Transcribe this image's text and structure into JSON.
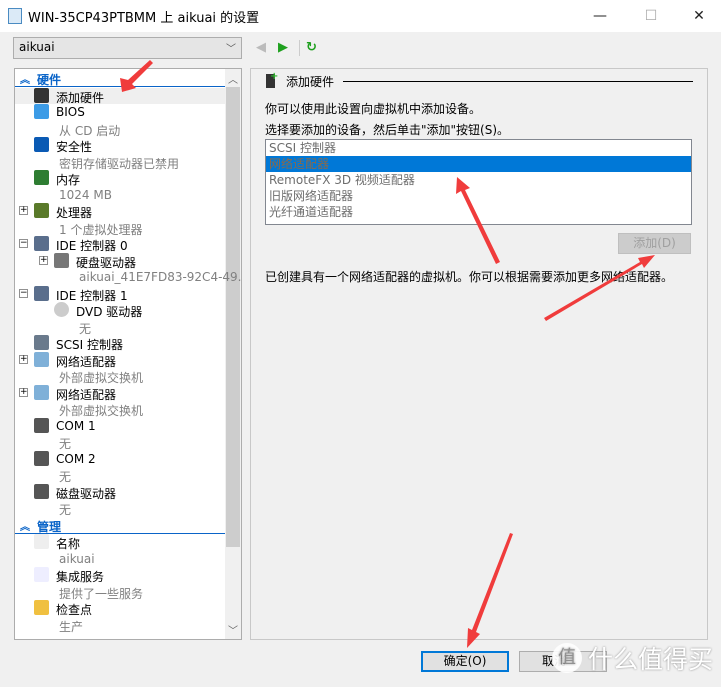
{
  "window": {
    "title": "WIN-35CP43PTBMM 上 aikuai 的设置",
    "minimize": "—",
    "maximize": "☐",
    "close": "✕"
  },
  "toolbar": {
    "vm_select": "aikuai",
    "back": "◀",
    "forward": "▶",
    "refresh": "↻"
  },
  "sidebar": {
    "hardware_label": "硬件",
    "management_label": "管理",
    "hardware": [
      {
        "label": "添加硬件",
        "sub": null,
        "expander": null,
        "icon": "add-hardware-icon"
      },
      {
        "label": "BIOS",
        "sub": "从 CD 启动",
        "expander": null,
        "icon": "bios-monitor-icon"
      },
      {
        "label": "安全性",
        "sub": "密钥存储驱动器已禁用",
        "expander": null,
        "icon": "shield-icon"
      },
      {
        "label": "内存",
        "sub": "1024 MB",
        "expander": null,
        "icon": "memory-icon"
      },
      {
        "label": "处理器",
        "sub": "1 个虚拟处理器",
        "expander": "+",
        "icon": "cpu-icon"
      },
      {
        "label": "IDE 控制器 0",
        "sub": null,
        "expander": "−",
        "icon": "ide-controller-icon"
      },
      {
        "label": "硬盘驱动器",
        "sub": "aikuai_41E7FD83-92C4-49...",
        "expander": "+",
        "icon": "hard-drive-icon",
        "child": true
      },
      {
        "label": "IDE 控制器 1",
        "sub": null,
        "expander": "−",
        "icon": "ide-controller-icon"
      },
      {
        "label": "DVD 驱动器",
        "sub": "无",
        "expander": null,
        "icon": "dvd-icon",
        "child": true
      },
      {
        "label": "SCSI 控制器",
        "sub": null,
        "expander": null,
        "icon": "scsi-icon"
      },
      {
        "label": "网络适配器",
        "sub": "外部虚拟交换机",
        "expander": "+",
        "icon": "network-adapter-icon"
      },
      {
        "label": "网络适配器",
        "sub": "外部虚拟交换机",
        "expander": "+",
        "icon": "network-adapter-icon"
      },
      {
        "label": "COM 1",
        "sub": "无",
        "expander": null,
        "icon": "com-port-icon"
      },
      {
        "label": "COM 2",
        "sub": "无",
        "expander": null,
        "icon": "com-port-icon"
      },
      {
        "label": "磁盘驱动器",
        "sub": "无",
        "expander": null,
        "icon": "floppy-icon"
      }
    ],
    "management": [
      {
        "label": "名称",
        "sub": "aikuai",
        "icon": "name-icon"
      },
      {
        "label": "集成服务",
        "sub": "提供了一些服务",
        "icon": "integration-services-icon"
      },
      {
        "label": "检查点",
        "sub": "生产",
        "icon": "checkpoint-icon"
      }
    ]
  },
  "main": {
    "section_title": "添加硬件",
    "desc1": "你可以使用此设置向虚拟机中添加设备。",
    "desc2": "选择要添加的设备，然后单击\"添加\"按钮(S)。",
    "devices": [
      "SCSI 控制器",
      "网络适配器",
      "RemoteFX 3D 视频适配器",
      "旧版网络适配器",
      "光纤通道适配器"
    ],
    "selected_index": 1,
    "add_button": "添加(D)",
    "note": "已创建具有一个网络适配器的虚拟机。你可以根据需要添加更多网络适配器。"
  },
  "footer": {
    "ok": "确定(O)",
    "cancel": "取消"
  },
  "watermark": {
    "logo": "值",
    "text": "什么值得买"
  },
  "colors": {
    "accent": "#0078d7",
    "section": "#0a64c8",
    "annotation_arrow": "#f03c3c"
  }
}
